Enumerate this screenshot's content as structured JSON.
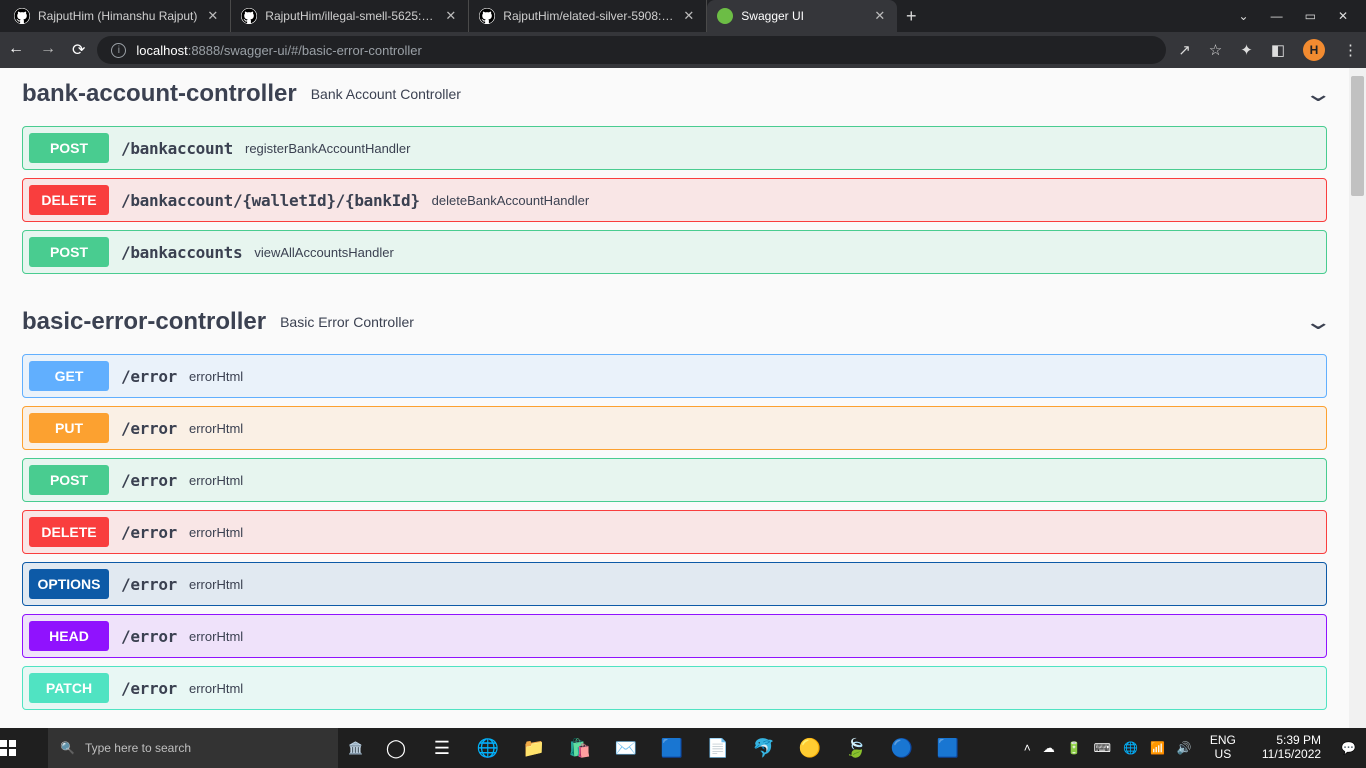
{
  "browser": {
    "tabs": [
      {
        "title": "RajputHim (Himanshu Rajput)",
        "favicon": "github"
      },
      {
        "title": "RajputHim/illegal-smell-5625: Ha",
        "favicon": "github"
      },
      {
        "title": "RajputHim/elated-silver-5908: On",
        "favicon": "github"
      },
      {
        "title": "Swagger UI",
        "favicon": "swagger",
        "active": true
      }
    ],
    "url_host": "localhost",
    "url_rest": ":8888/swagger-ui/#/basic-error-controller",
    "avatar_letter": "H"
  },
  "swagger": {
    "tags": [
      {
        "name": "bank-account-controller",
        "desc": "Bank Account Controller",
        "ops": [
          {
            "method": "POST",
            "method_class": "m-post",
            "path": "/bankaccount",
            "summary": "registerBankAccountHandler"
          },
          {
            "method": "DELETE",
            "method_class": "m-delete",
            "path": "/bankaccount/{walletId}/{bankId}",
            "summary": "deleteBankAccountHandler"
          },
          {
            "method": "POST",
            "method_class": "m-post",
            "path": "/bankaccounts",
            "summary": "viewAllAccountsHandler"
          }
        ]
      },
      {
        "name": "basic-error-controller",
        "desc": "Basic Error Controller",
        "ops": [
          {
            "method": "GET",
            "method_class": "m-get",
            "path": "/error",
            "summary": "errorHtml"
          },
          {
            "method": "PUT",
            "method_class": "m-put",
            "path": "/error",
            "summary": "errorHtml"
          },
          {
            "method": "POST",
            "method_class": "m-post",
            "path": "/error",
            "summary": "errorHtml"
          },
          {
            "method": "DELETE",
            "method_class": "m-delete",
            "path": "/error",
            "summary": "errorHtml"
          },
          {
            "method": "OPTIONS",
            "method_class": "m-options",
            "path": "/error",
            "summary": "errorHtml"
          },
          {
            "method": "HEAD",
            "method_class": "m-head",
            "path": "/error",
            "summary": "errorHtml"
          },
          {
            "method": "PATCH",
            "method_class": "m-patch",
            "path": "/error",
            "summary": "errorHtml"
          }
        ]
      }
    ]
  },
  "taskbar": {
    "search_placeholder": "Type here to search",
    "lang_top": "ENG",
    "lang_bot": "US",
    "time": "5:39 PM",
    "date": "11/15/2022"
  }
}
